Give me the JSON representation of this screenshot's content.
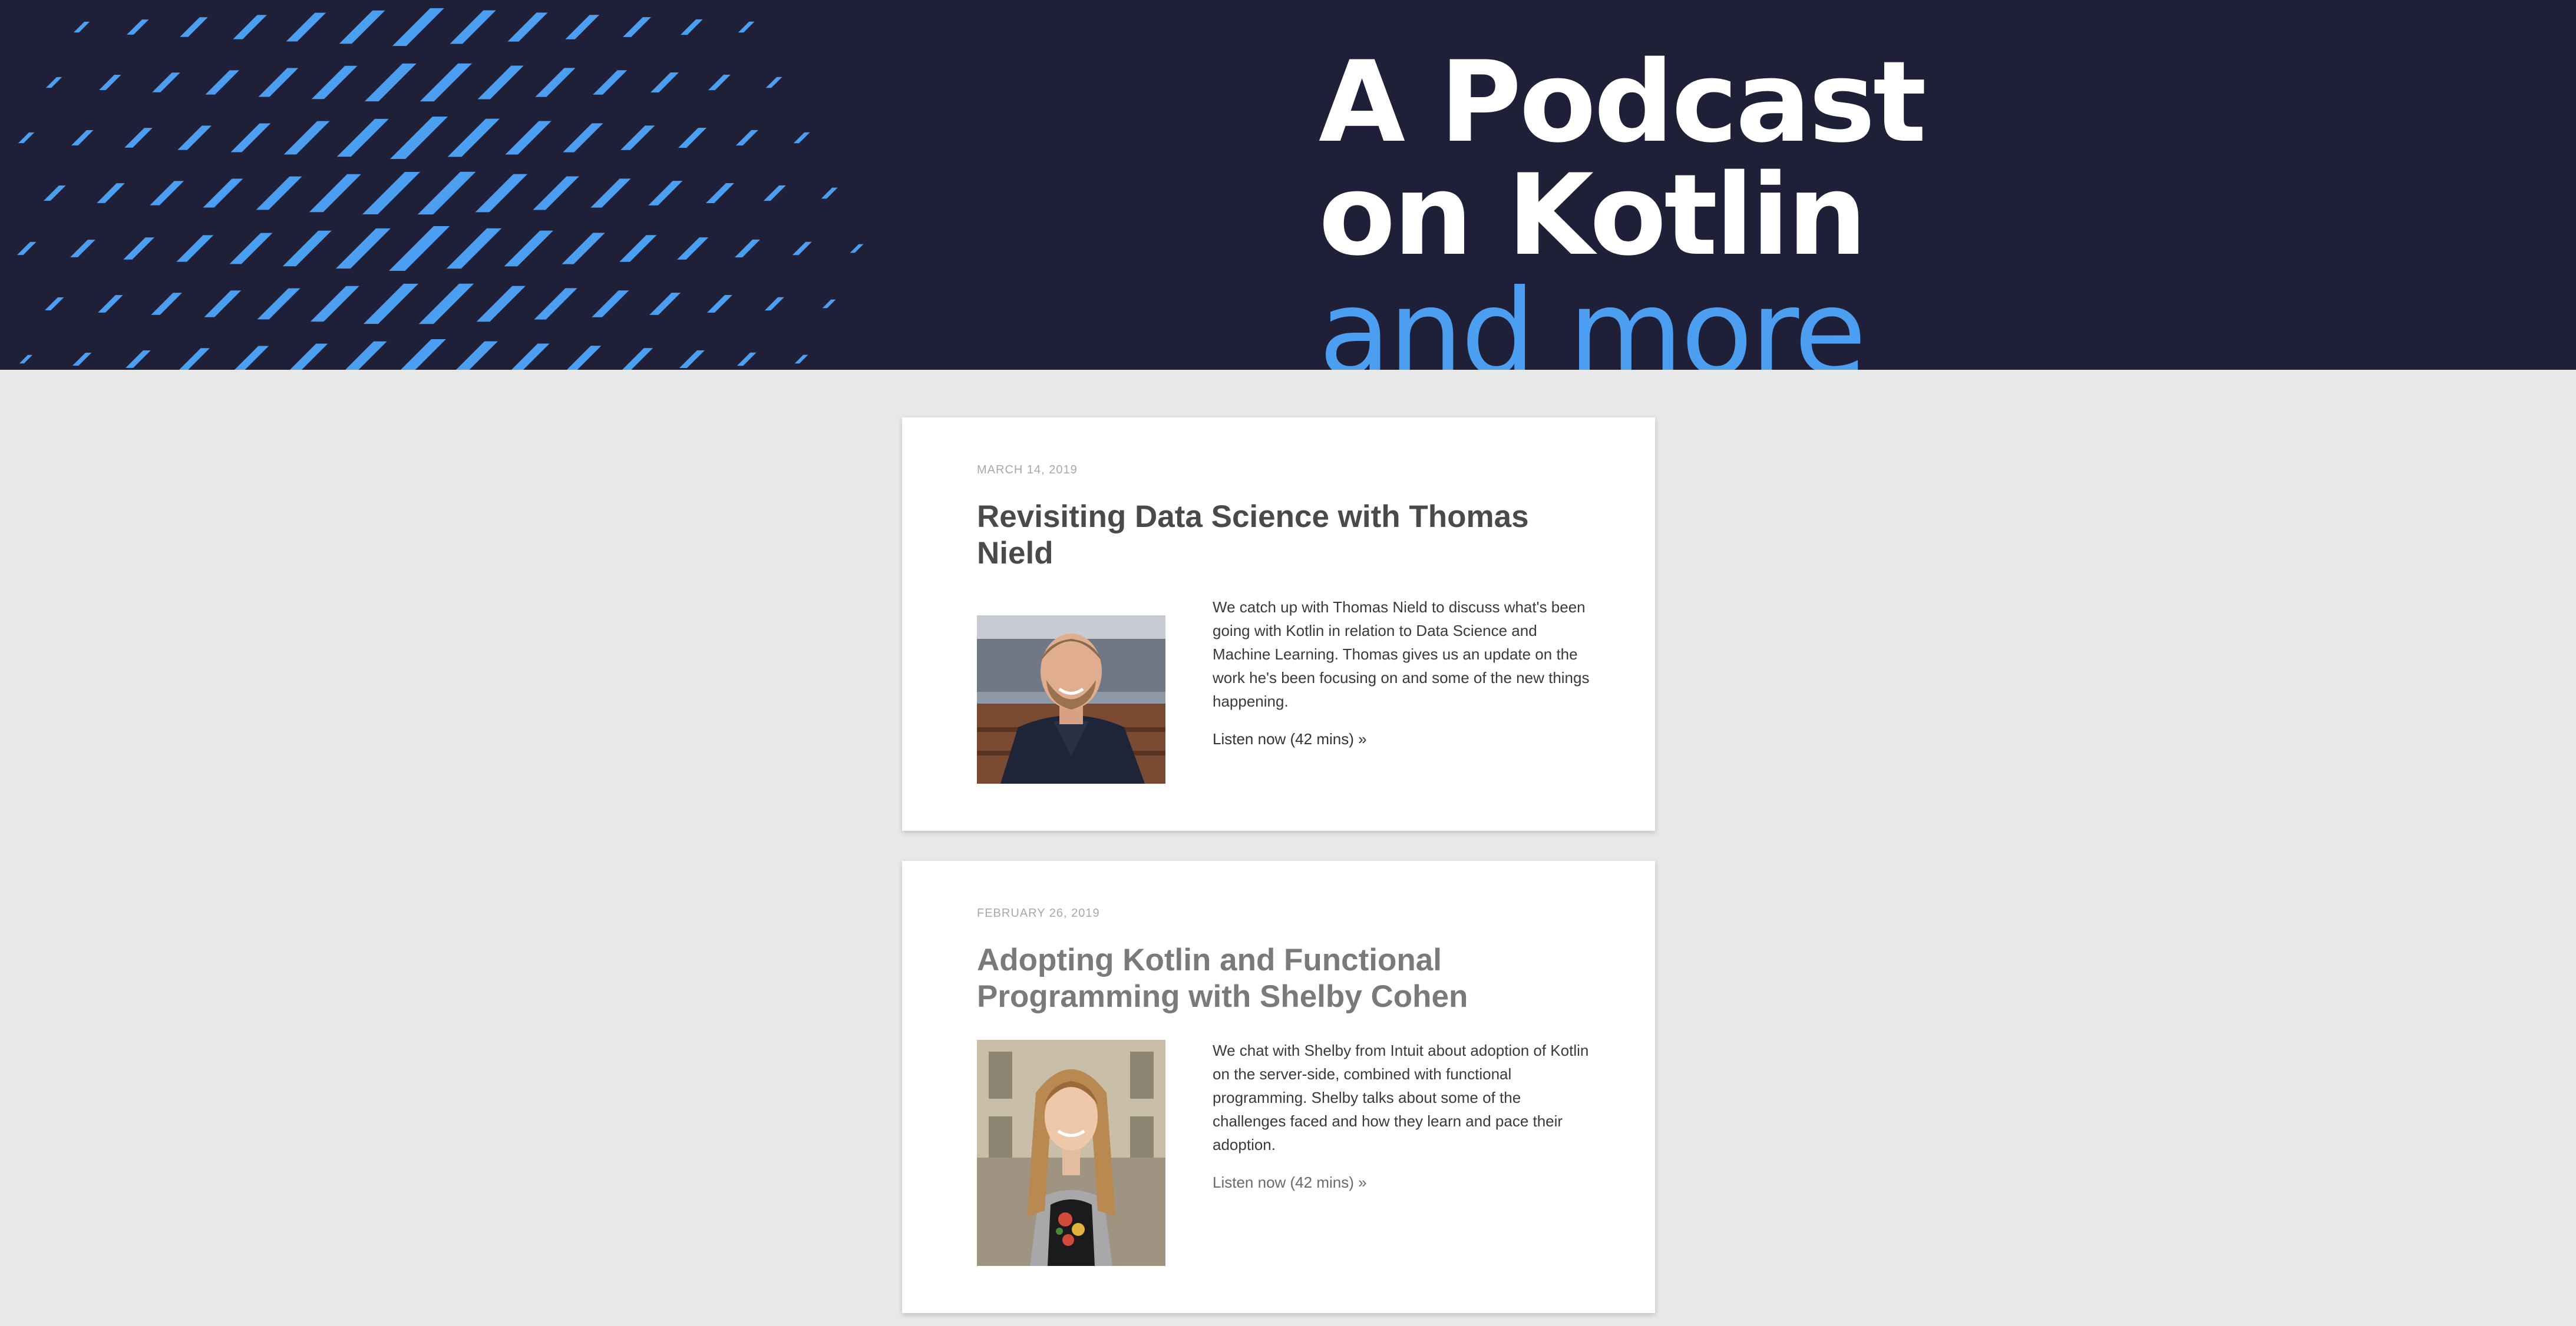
{
  "hero": {
    "title_line1": "A Podcast",
    "title_line2": "on Kotlin",
    "accent": "and more",
    "background_color": "#201f38",
    "accent_color": "#4c9ef0"
  },
  "episodes": [
    {
      "date": "MARCH 14, 2019",
      "title": "Revisiting Data Science with Thomas Nield",
      "description": "We catch up with Thomas Nield to discuss what's been going with Kotlin in relation to Data Science and Machine Learning. Thomas gives us an update on the work he's been focusing on and some of the new things happening.",
      "link_text": "Listen now (42 mins) »",
      "photo_icon": "guest-photo-thomas-nield"
    },
    {
      "date": "FEBRUARY 26, 2019",
      "title": "Adopting Kotlin and Functional Programming with Shelby Cohen",
      "description": "We chat with Shelby from Intuit about adoption of Kotlin on the server-side, combined with functional programming. Shelby talks about some of the challenges faced and how they learn and pace their adoption.",
      "link_text": "Listen now (42 mins) »",
      "photo_icon": "guest-photo-shelby-cohen"
    }
  ]
}
